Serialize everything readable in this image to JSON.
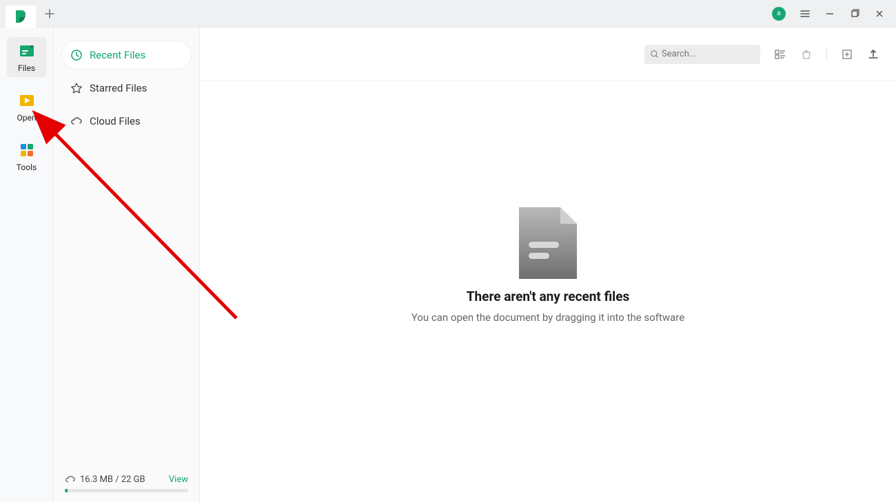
{
  "titlebar": {
    "avatar_letter": "a"
  },
  "rail": {
    "items": [
      {
        "label": "Files"
      },
      {
        "label": "Open"
      },
      {
        "label": "Tools"
      }
    ]
  },
  "sidebar": {
    "filters": [
      {
        "label": "Recent Files"
      },
      {
        "label": "Starred Files"
      },
      {
        "label": "Cloud Files"
      }
    ],
    "storage_text": "16.3 MB / 22 GB",
    "view_label": "View"
  },
  "toolbar": {
    "search_placeholder": "Search..."
  },
  "empty": {
    "title": "There aren't any recent files",
    "subtitle": "You can open the document by dragging it into the software"
  }
}
